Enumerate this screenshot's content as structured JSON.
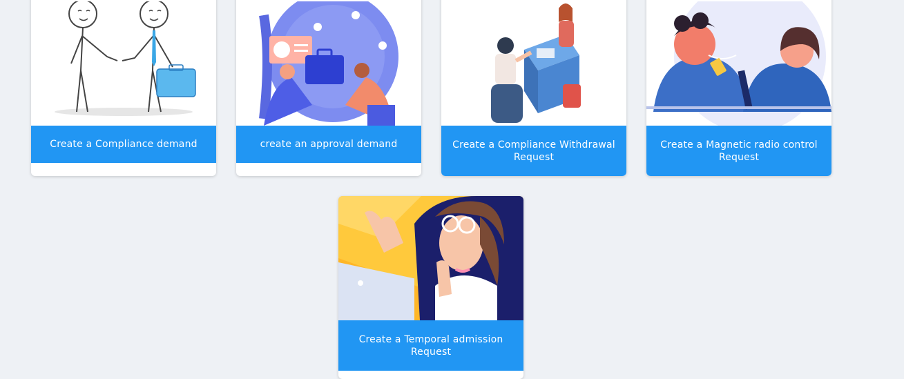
{
  "cards": [
    {
      "title": "Create a Compliance demand",
      "illustration": "handshake-sketch-icon"
    },
    {
      "title": "create an approval demand",
      "illustration": "business-deal-globe-icon"
    },
    {
      "title": "Create a Compliance Withdrawal Request",
      "illustration": "office-desk-meeting-icon"
    },
    {
      "title": "Create a Magnetic radio control Request",
      "illustration": "ticket-exchange-icon"
    },
    {
      "title": "Create a Temporal admission Request",
      "illustration": "woman-laptop-icon"
    }
  ],
  "colors": {
    "background": "#eef1f5",
    "card_label": "#2196f3",
    "card_body": "#ffffff"
  }
}
